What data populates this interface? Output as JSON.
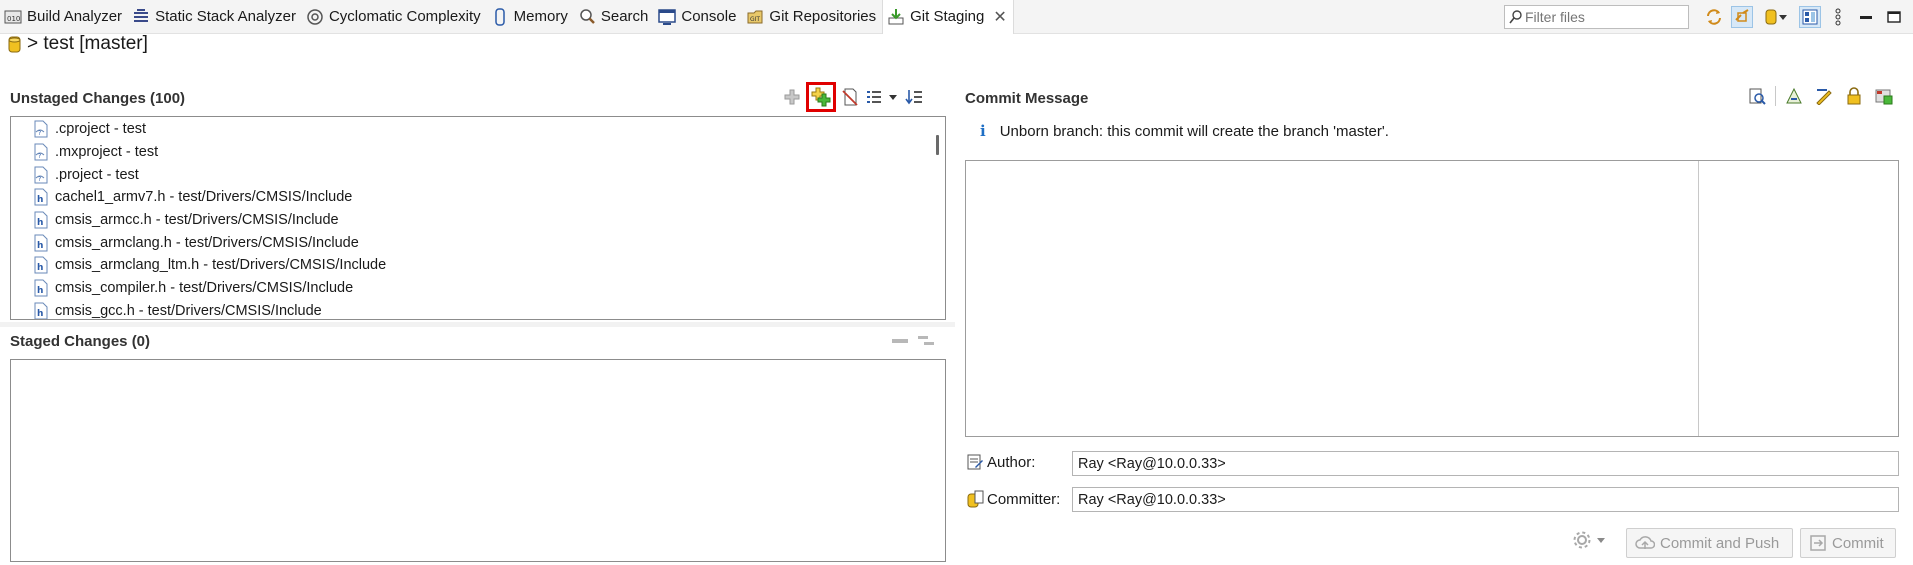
{
  "tabs": [
    {
      "label": "Build Analyzer",
      "icon": "build-analyzer-icon"
    },
    {
      "label": "Static Stack Analyzer",
      "icon": "stack-analyzer-icon"
    },
    {
      "label": "Cyclomatic Complexity",
      "icon": "complexity-icon"
    },
    {
      "label": "Memory",
      "icon": "memory-icon"
    },
    {
      "label": "Search",
      "icon": "search-icon"
    },
    {
      "label": "Console",
      "icon": "console-icon"
    },
    {
      "label": "Git Repositories",
      "icon": "git-repositories-icon"
    },
    {
      "label": "Git Staging",
      "icon": "git-staging-icon",
      "active": true
    }
  ],
  "filter": {
    "placeholder": "Filter files"
  },
  "repo": {
    "title": "> test [master]"
  },
  "unstaged": {
    "header": "Unstaged Changes (100)",
    "files": [
      ".cproject - test",
      ".mxproject - test",
      ".project - test",
      "cachel1_armv7.h - test/Drivers/CMSIS/Include",
      "cmsis_armcc.h - test/Drivers/CMSIS/Include",
      "cmsis_armclang.h - test/Drivers/CMSIS/Include",
      "cmsis_armclang_ltm.h - test/Drivers/CMSIS/Include",
      "cmsis_compiler.h - test/Drivers/CMSIS/Include",
      "cmsis_gcc.h - test/Drivers/CMSIS/Include"
    ]
  },
  "staged": {
    "header": "Staged Changes (0)"
  },
  "commit": {
    "header": "Commit Message",
    "info": "Unborn branch: this commit will create the branch 'master'.",
    "author_label": "Author:",
    "author_value": "Ray <Ray@10.0.0.33>",
    "committer_label": "Committer:",
    "committer_value": "Ray <Ray@10.0.0.33>",
    "commit_and_push_label": "Commit and Push",
    "commit_label": "Commit"
  },
  "colors": {
    "accent": "#1f6fc5",
    "highlight": "#e00000",
    "git_green": "#3a9a2a"
  }
}
